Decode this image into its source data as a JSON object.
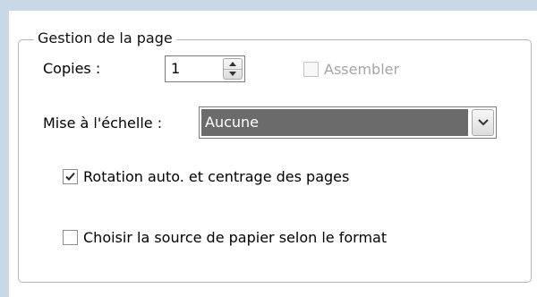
{
  "page_handling": {
    "legend": "Gestion de la page",
    "copies_label": "Copies :",
    "copies_value": "1",
    "collate_label": "Assembler",
    "collate_checked": false,
    "collate_enabled": false,
    "scaling_label": "Mise à l'échelle :",
    "scaling_value": "Aucune",
    "auto_rotate_label": "Rotation auto. et centrage des pages",
    "auto_rotate_checked": true,
    "paper_source_label": "Choisir la source de papier selon le format",
    "paper_source_checked": false
  }
}
